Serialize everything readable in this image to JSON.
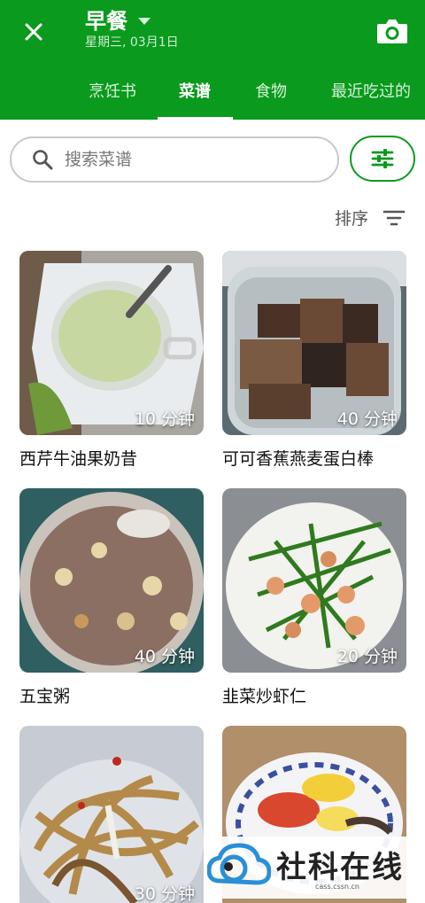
{
  "header": {
    "title": "早餐",
    "subtitle": "星期三, 03月1日",
    "tabs": [
      "烹饪书",
      "菜谱",
      "食物",
      "最近吃过的"
    ],
    "active_tab": 1
  },
  "search": {
    "placeholder": "搜索菜谱",
    "value": ""
  },
  "sort": {
    "label": "排序"
  },
  "recipes": [
    {
      "name": "西芹牛油果奶昔",
      "time": "10 分钟"
    },
    {
      "name": "可可香蕉燕麦蛋白棒",
      "time": "40 分钟"
    },
    {
      "name": "五宝粥",
      "time": "40 分钟"
    },
    {
      "name": "韭菜炒虾仁",
      "time": "20 分钟"
    },
    {
      "name": "",
      "time": "30 分钟"
    },
    {
      "name": "",
      "time": ""
    }
  ],
  "watermark": {
    "text": "社科在线",
    "url": "cass.cssn.cn"
  },
  "colors": {
    "brand": "#0a9a1e"
  }
}
